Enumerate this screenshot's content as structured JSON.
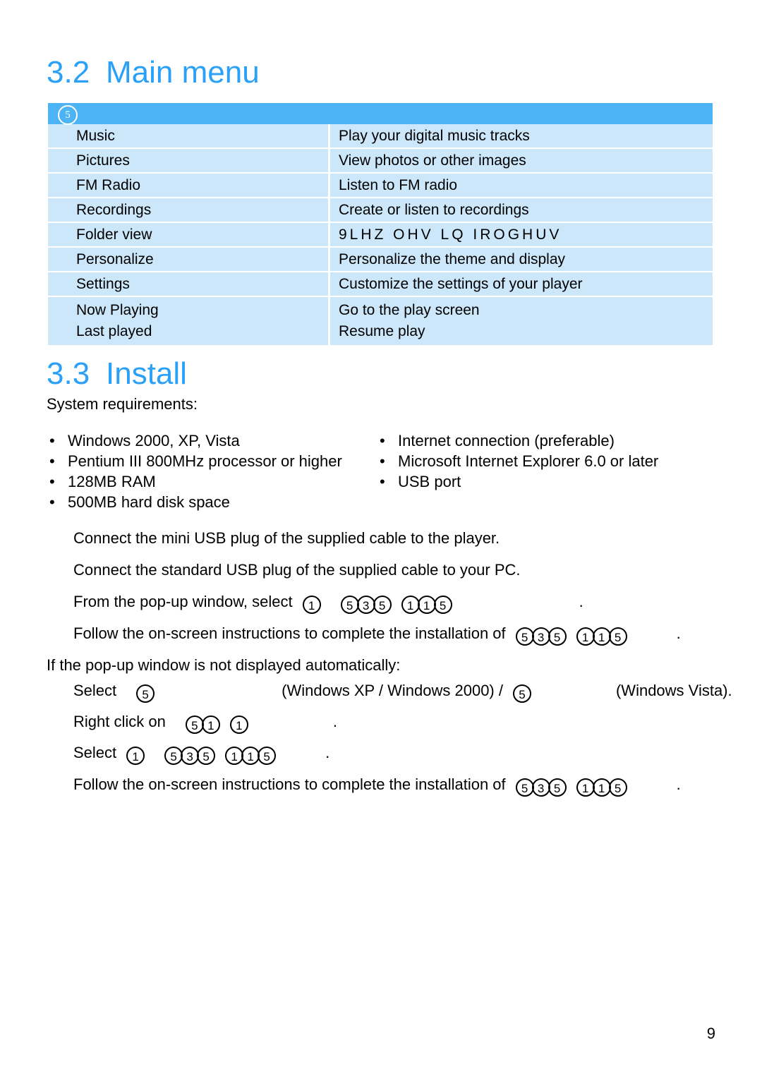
{
  "sections": {
    "main_menu": {
      "number": "3.2",
      "title": "Main menu"
    },
    "install": {
      "number": "3.3",
      "title": "Install"
    }
  },
  "menu_table": {
    "badge": "5",
    "rows": [
      {
        "label": "Music",
        "desc": "Play your digital music tracks"
      },
      {
        "label": "Pictures",
        "desc": "View photos or other images"
      },
      {
        "label": "FM Radio",
        "desc": "Listen to FM radio"
      },
      {
        "label": "Recordings",
        "desc": "Create or listen to recordings"
      },
      {
        "label": "Folder view",
        "desc": "9LHZ  OHV LQ IROGHUV"
      },
      {
        "label": "Personalize",
        "desc": "Personalize the theme and display"
      },
      {
        "label": "Settings",
        "desc": "Customize the settings of your player"
      }
    ],
    "tall_row": {
      "label_line1": "Now Playing",
      "label_line2": "Last played",
      "desc_line1": "Go to the play screen",
      "desc_line2": "Resume play"
    }
  },
  "install": {
    "system_requirements_label": "System requirements:",
    "bullets_left": [
      "Windows 2000, XP, Vista",
      "Pentium III 800MHz processor or higher",
      "128MB RAM",
      "500MB hard disk space"
    ],
    "bullets_right": [
      "Internet connection (preferable)",
      "Microsoft Internet Explorer 6.0 or later",
      "USB port"
    ],
    "bullet_glyph": "•",
    "step_connect_mini": "Connect the mini USB plug of the supplied cable to the player.",
    "step_connect_standard": "Connect the standard USB plug of the supplied cable to your PC.",
    "step_popup_prefix": "From the pop-up window, select",
    "step_popup_codes_a": [
      "1"
    ],
    "step_popup_codes_b": [
      "5",
      "3",
      "5"
    ],
    "step_popup_codes_c": [
      "1",
      "1",
      "5"
    ],
    "step_popup_suffix": ".",
    "step_follow_prefix": "Follow the on-screen instructions to complete the installation of",
    "step_follow_codes_a": [
      "5",
      "3",
      "5"
    ],
    "step_follow_codes_b": [
      "1",
      "1",
      "5"
    ],
    "step_follow_suffix": ".",
    "not_displayed_label": "If the pop-up window is not displayed automatically:",
    "step_select_prefix": "Select",
    "step_select_code1": "5",
    "step_select_mid": "(Windows XP / Windows 2000) /",
    "step_select_code2": "5",
    "step_select_tail": "(Windows Vista).",
    "step_rightclick_prefix": "Right click on",
    "step_rightclick_codes_a": [
      "5",
      "1"
    ],
    "step_rightclick_codes_b": [
      "1"
    ],
    "step_rightclick_suffix": ".",
    "step_select2_prefix": "Select",
    "step_select2_codes_a": [
      "1"
    ],
    "step_select2_codes_b": [
      "5",
      "3",
      "5"
    ],
    "step_select2_codes_c": [
      "1",
      "1",
      "5"
    ],
    "step_select2_suffix": "."
  },
  "footer": {
    "page_number": "9"
  },
  "colors": {
    "heading_blue": "#2aa1f7",
    "table_header_blue": "#4cb4f5",
    "table_row_blue": "#cce7fa",
    "text_black": "#000000",
    "page_background": "#ffffff"
  }
}
